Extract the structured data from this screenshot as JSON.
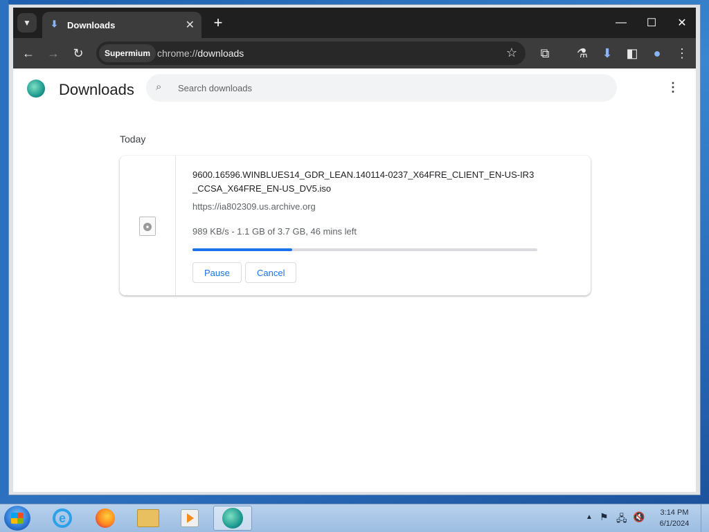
{
  "browser": {
    "tab": {
      "title": "Downloads",
      "close_glyph": "✕"
    },
    "new_tab_glyph": "+",
    "window_controls": {
      "minimize": "—",
      "maximize": "☐",
      "close": "✕"
    },
    "toolbar": {
      "back": "←",
      "forward": "→",
      "reload": "↻",
      "omnibox_chip": "Supermium",
      "url_scheme": "chrome://",
      "url_host": "downloads",
      "bookmark_glyph": "☆",
      "extensions_glyph": "⧉",
      "labs_glyph": "⚗",
      "download_glyph": "⬇",
      "sidepanel_glyph": "◧",
      "profile_glyph": "●",
      "menu_glyph": "⋮"
    }
  },
  "downloads_page": {
    "title": "Downloads",
    "search_placeholder": "Search downloads",
    "menu_glyph": "⋮",
    "section_date": "Today",
    "items": [
      {
        "file_name": "9600.16596.WINBLUES14_GDR_LEAN.140114-0237_X64FRE_CLIENT_EN-US-IR3_CCSA_X64FRE_EN-US_DV5.iso",
        "source": "https://ia802309.us.archive.org",
        "status": "989 KB/s - 1.1 GB of 3.7 GB, 46 mins left",
        "progress_fraction": 0.29,
        "pause_label": "Pause",
        "cancel_label": "Cancel"
      }
    ]
  },
  "taskbar": {
    "apps": [
      "internet-explorer-icon",
      "firefox-icon",
      "explorer-folder-icon",
      "media-player-icon",
      "supermium-icon"
    ],
    "tray": {
      "show_hidden": "▲",
      "flag": "⚑",
      "network": "🖧",
      "volume": "🔇"
    },
    "clock_time": "3:14 PM",
    "clock_date": "6/1/2024"
  },
  "colors": {
    "accent": "#1a73e8",
    "progress_track": "#dadce0",
    "titlebar": "#1f1f1f",
    "toolbar": "#3c3c3c"
  }
}
